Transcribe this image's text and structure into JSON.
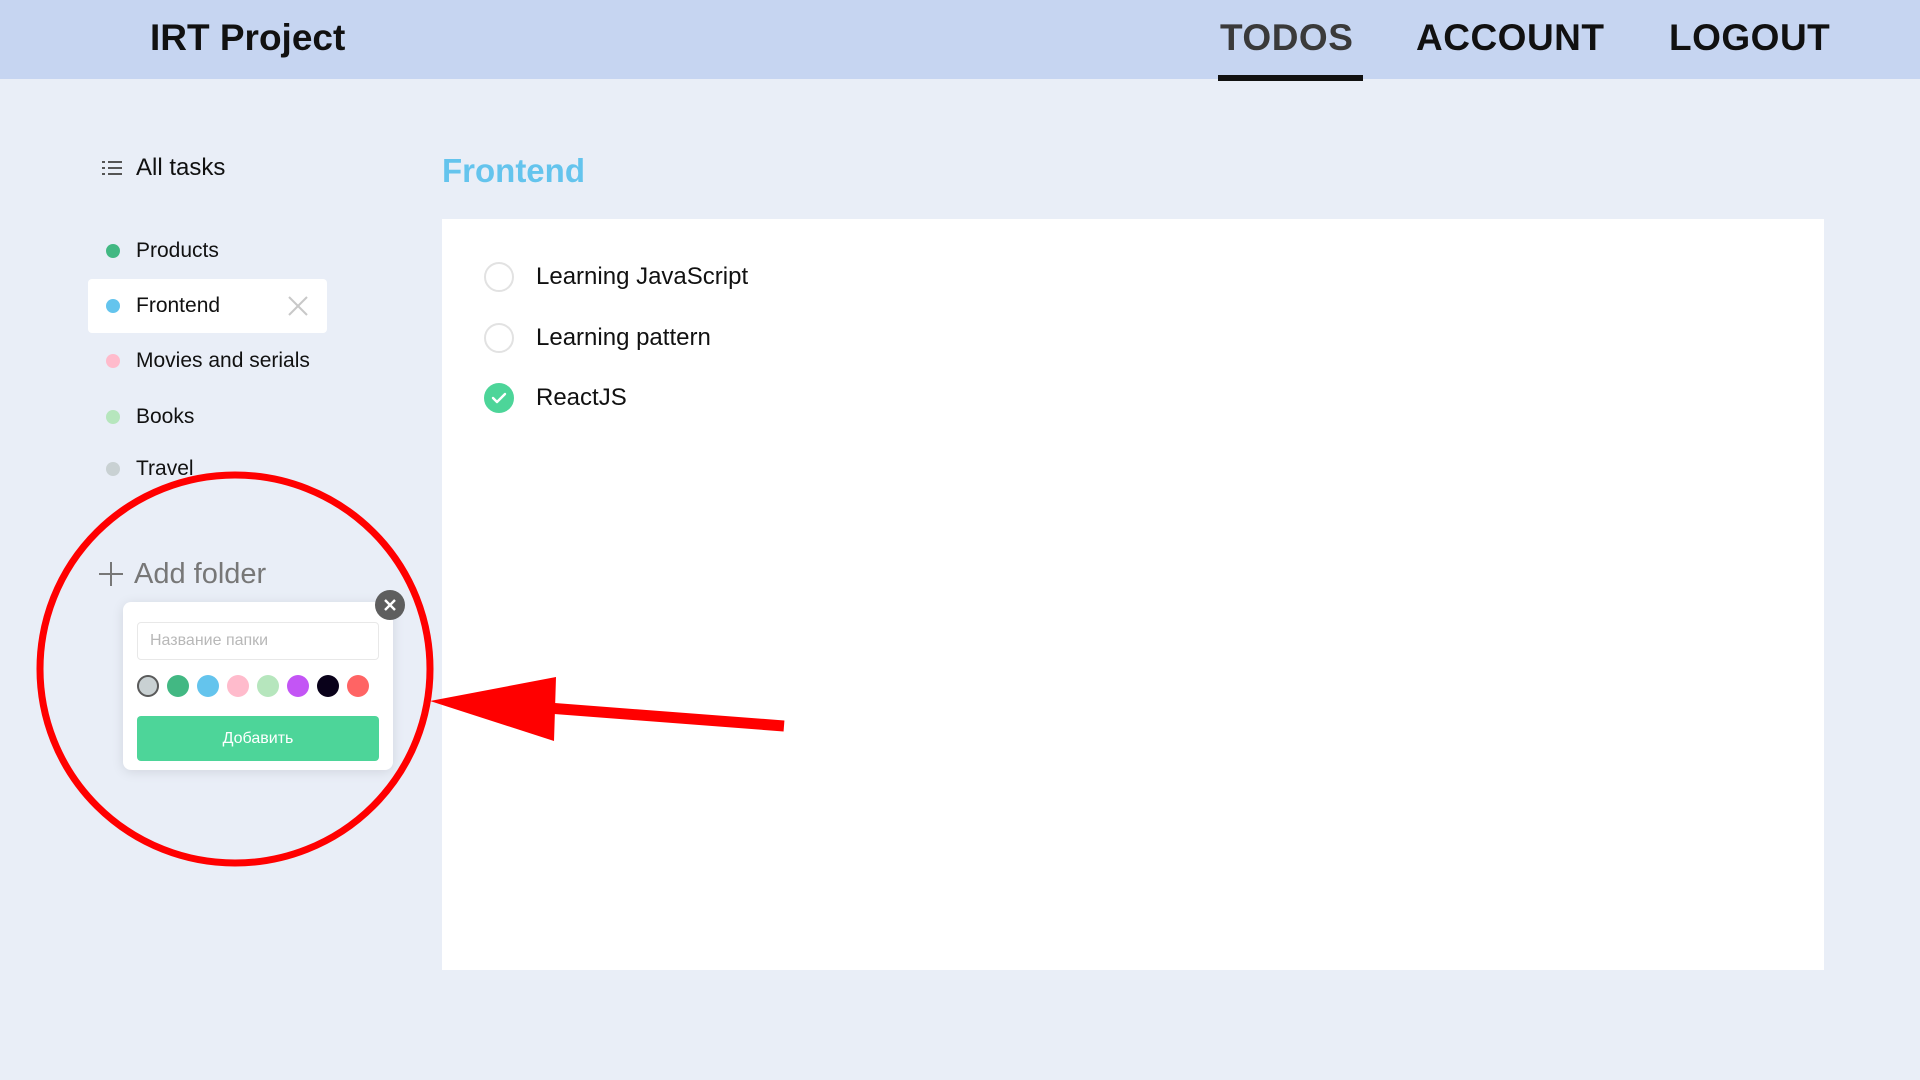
{
  "header": {
    "brand": "IRT Project",
    "nav": [
      {
        "label": "TODOS",
        "active": true
      },
      {
        "label": "ACCOUNT",
        "active": false
      },
      {
        "label": "LOGOUT",
        "active": false
      }
    ]
  },
  "sidebar": {
    "all_tasks_label": "All tasks",
    "folders": [
      {
        "label": "Products",
        "color": "#42b883",
        "active": false
      },
      {
        "label": "Frontend",
        "color": "#64c4ed",
        "active": true
      },
      {
        "label": "Movies and serials",
        "color": "#ffbbcc",
        "active": false
      },
      {
        "label": "Books",
        "color": "#b6e6bd",
        "active": false
      },
      {
        "label": "Travel",
        "color": "#c9d1d3",
        "active": false
      }
    ],
    "add_folder_label": "Add folder"
  },
  "popup": {
    "input_placeholder": "Название папки",
    "input_value": "",
    "colors": [
      "#c9d1d3",
      "#42b883",
      "#64c4ed",
      "#ffbbcc",
      "#b6e6bd",
      "#c355f5",
      "#09011a",
      "#ff6464"
    ],
    "selected_color": "#c9d1d3",
    "submit_label": "Добавить"
  },
  "main": {
    "title": "Frontend",
    "title_color": "#64c4ed",
    "tasks": [
      {
        "label": "Learning JavaScript",
        "completed": false
      },
      {
        "label": "Learning pattern",
        "completed": false
      },
      {
        "label": "ReactJS",
        "completed": true
      }
    ]
  },
  "annotation_color": "#ff0000"
}
